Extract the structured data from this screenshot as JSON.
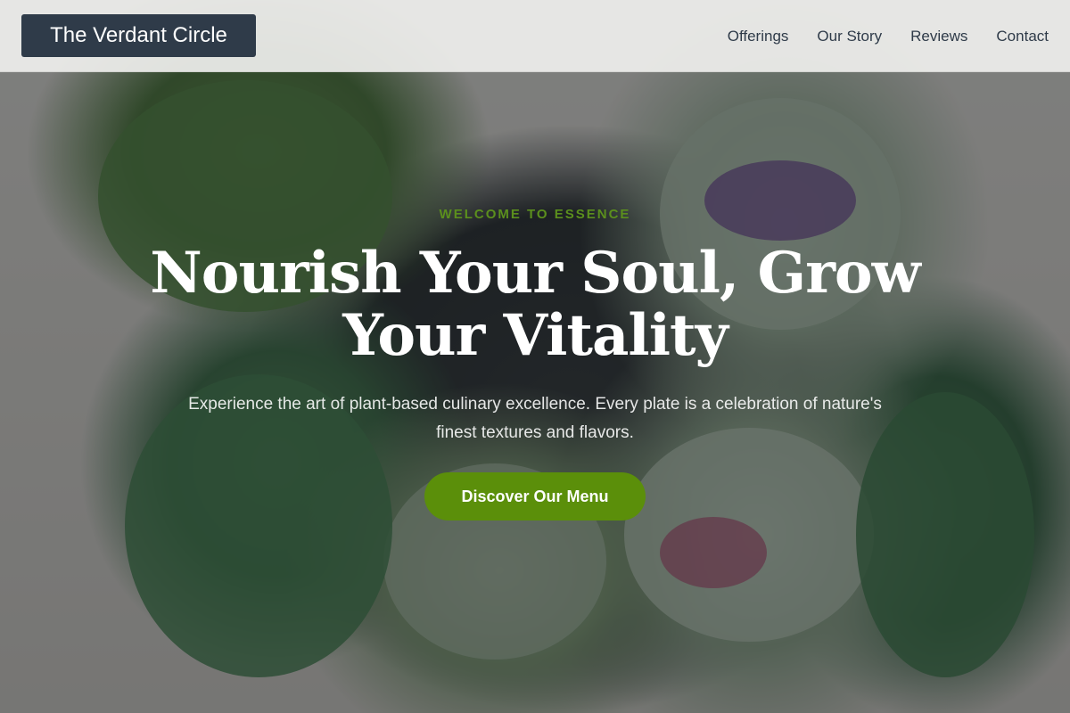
{
  "header": {
    "brand": "The Verdant Circle",
    "nav": [
      {
        "label": "Offerings"
      },
      {
        "label": "Our Story"
      },
      {
        "label": "Reviews"
      },
      {
        "label": "Contact"
      }
    ]
  },
  "hero": {
    "eyebrow": "WELCOME TO ESSENCE",
    "headline": "Nourish Your Soul, Grow Your Vitality",
    "subhead": "Experience the art of plant-based culinary excellence. Every plate is a celebration of nature's finest textures and flavors.",
    "cta_label": "Discover Our Menu"
  },
  "colors": {
    "brand_bg": "#2f3b49",
    "accent": "#5b8f0a",
    "eyebrow": "#5b8f1d"
  }
}
